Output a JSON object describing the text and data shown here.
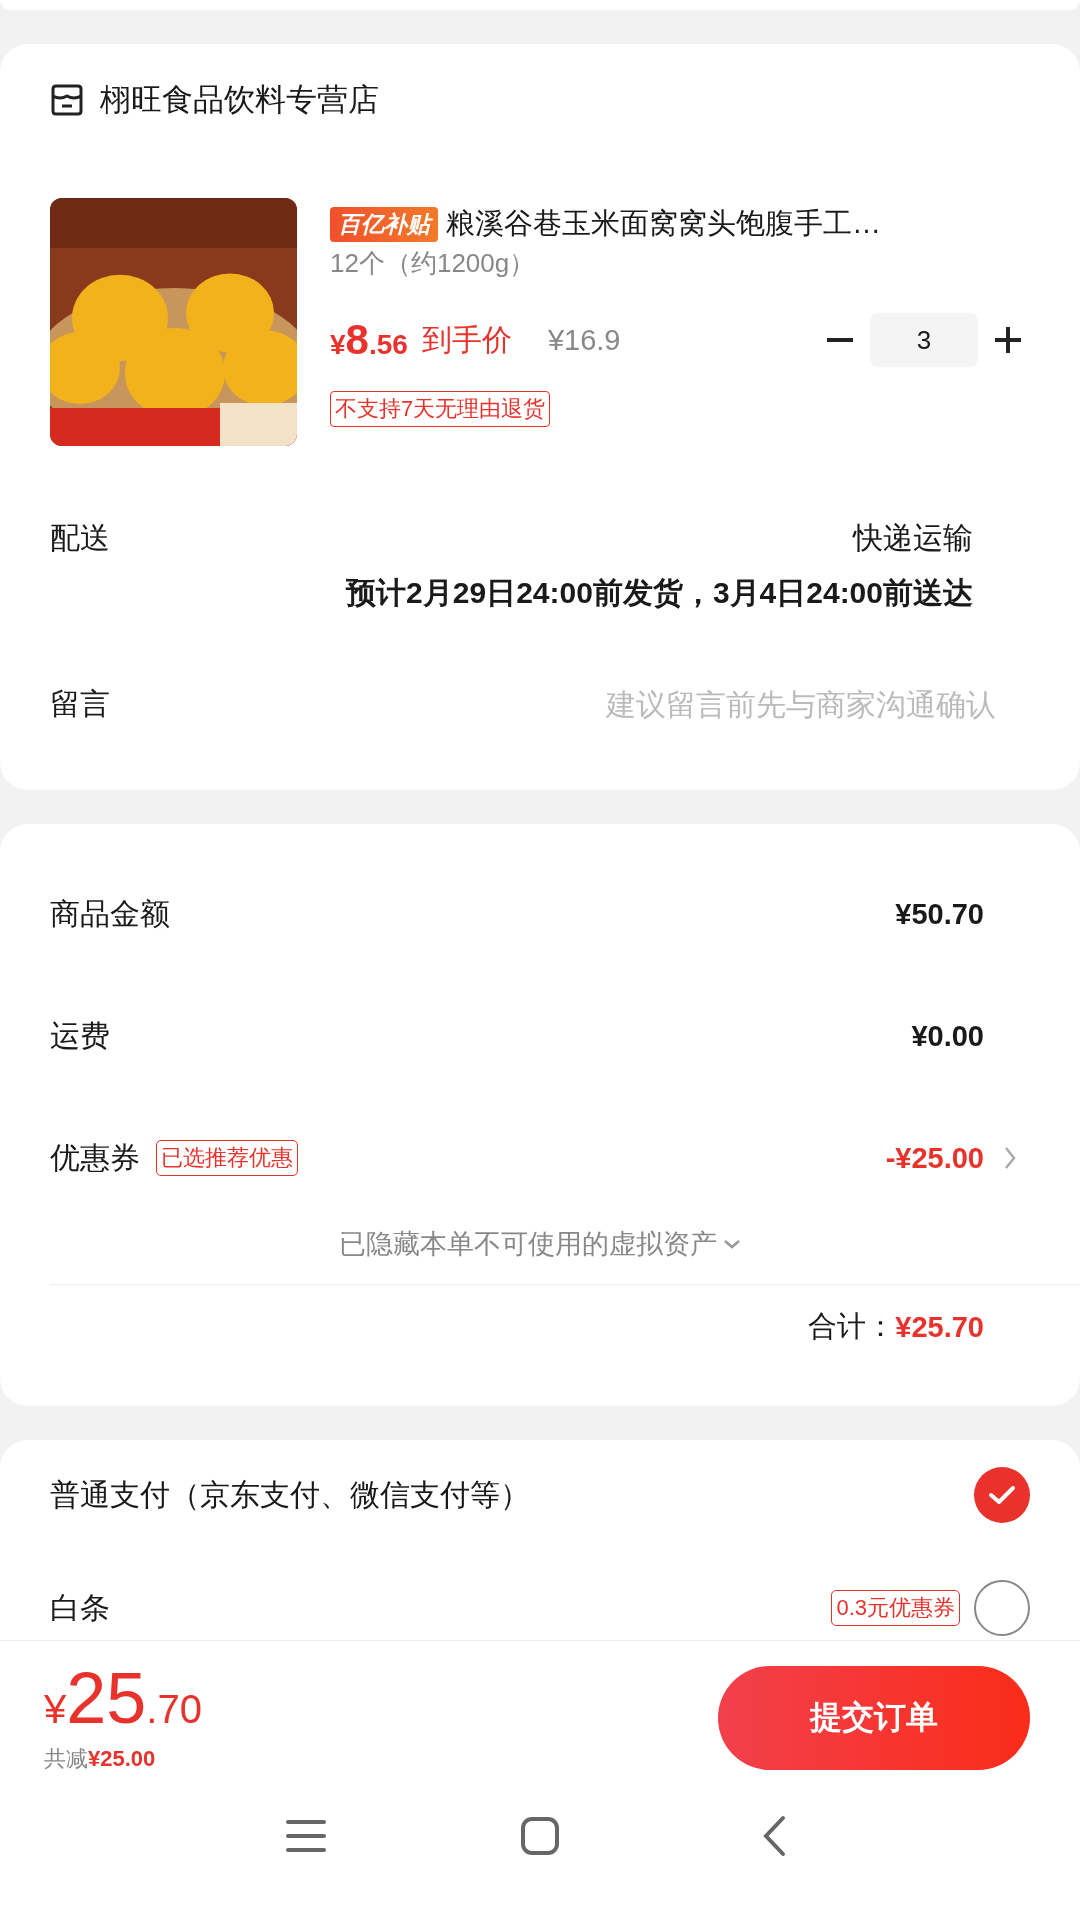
{
  "store": {
    "name": "栩旺食品饮料专营店"
  },
  "product": {
    "badge": "百亿补贴",
    "title": "粮溪谷巷玉米面窝窝头饱腹手工…",
    "spec": "12个（约1200g）",
    "price_symbol": "¥",
    "price_int": "8",
    "price_dec": ".56",
    "price_label": "到手价",
    "original_price": "¥16.9",
    "quantity": "3",
    "notice": "不支持7天无理由退货"
  },
  "delivery": {
    "label": "配送",
    "method": "快递运输",
    "estimate": "预计2月29日24:00前发货，3月4日24:00前送达"
  },
  "message": {
    "label": "留言",
    "placeholder": "建议留言前先与商家沟通确认"
  },
  "summary": {
    "rows": [
      {
        "kind": "plain",
        "label": "商品金额",
        "value": "¥50.70"
      },
      {
        "kind": "plain",
        "label": "运费",
        "value": "¥0.00"
      },
      {
        "kind": "discount",
        "label": "优惠券",
        "tag": "已选推荐优惠",
        "value": "-¥25.00"
      }
    ],
    "hidden_note": "已隐藏本单不可使用的虚拟资产",
    "total_label": "合计：",
    "total": "¥25.70"
  },
  "payment": [
    {
      "label": "普通支付（京东支付、微信支付等）",
      "selected": true
    },
    {
      "label": "白条",
      "tag": "0.3元优惠券",
      "selected": false
    }
  ],
  "footer": {
    "price_symbol": "¥",
    "price_int": "25",
    "price_dec": ".70",
    "saved_label": "共减",
    "saved": "¥25.00",
    "submit": "提交订单"
  }
}
